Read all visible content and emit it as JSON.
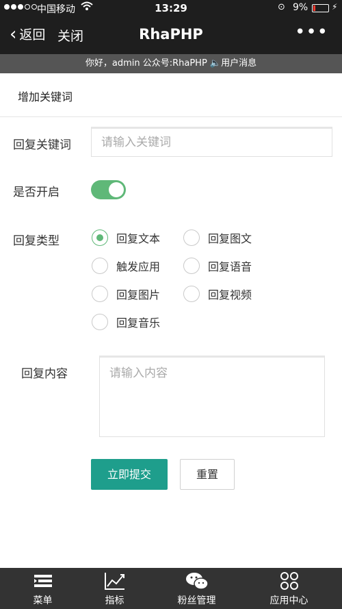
{
  "status_bar": {
    "carrier": "中国移动",
    "time": "13:29",
    "battery": "9%"
  },
  "nav": {
    "back_label": "返回",
    "close_label": "关闭",
    "title": "RhaPHP"
  },
  "notice": "你好，admin 公众号:RhaPHP 🔈用户消息",
  "page_title": "增加关键词",
  "form": {
    "keyword_label": "回复关键词",
    "keyword_placeholder": "请输入关键词",
    "enable_label": "是否开启",
    "enabled": true,
    "type_label": "回复类型",
    "types": [
      "回复文本",
      "回复图文",
      "触发应用",
      "回复语音",
      "回复图片",
      "回复视频",
      "回复音乐"
    ],
    "selected_type": "回复文本",
    "content_label": "回复内容",
    "content_placeholder": "请输入内容",
    "submit_label": "立即提交",
    "reset_label": "重置"
  },
  "tabbar": {
    "items": [
      {
        "label": "菜单",
        "icon": "menu-icon"
      },
      {
        "label": "指标",
        "icon": "chart-icon"
      },
      {
        "label": "粉丝管理",
        "icon": "wechat-icon"
      },
      {
        "label": "应用中心",
        "icon": "apps-icon"
      }
    ]
  },
  "colors": {
    "accent_green": "#5fb878",
    "primary_button": "#1e9e8c",
    "topbar": "#1e1e1e",
    "tabbar": "#333333"
  }
}
